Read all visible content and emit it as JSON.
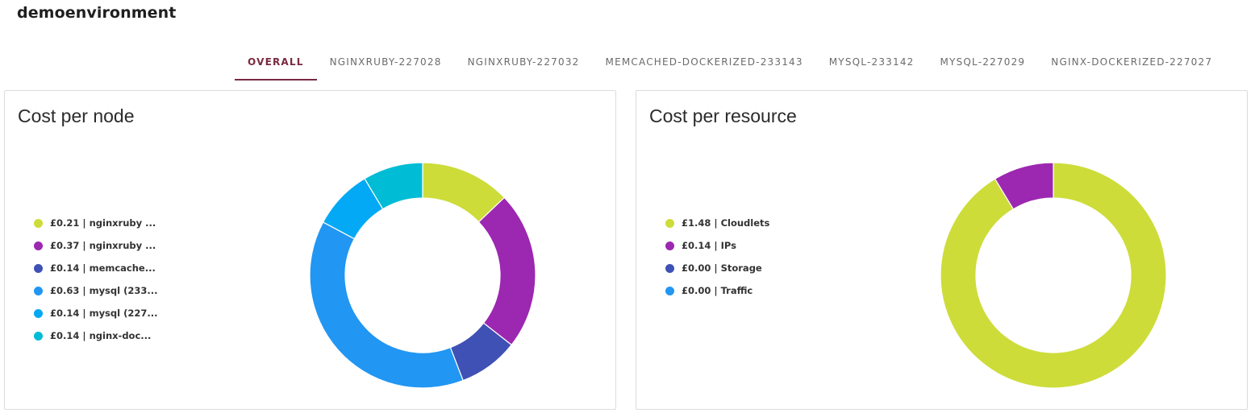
{
  "environment": {
    "name": "demoenvironment"
  },
  "tabs": [
    {
      "label": "OVERALL",
      "active": true
    },
    {
      "label": "NGINXRUBY-227028",
      "active": false
    },
    {
      "label": "NGINXRUBY-227032",
      "active": false
    },
    {
      "label": "MEMCACHED-DOCKERIZED-233143",
      "active": false
    },
    {
      "label": "MYSQL-233142",
      "active": false
    },
    {
      "label": "MYSQL-227029",
      "active": false
    },
    {
      "label": "NGINX-DOCKERIZED-227027",
      "active": false
    }
  ],
  "cost_per_node": {
    "title": "Cost per node",
    "legend": [
      {
        "label": "£0.21 | nginxruby ...",
        "color": "#cddc39"
      },
      {
        "label": "£0.37 | nginxruby ...",
        "color": "#9c27b0"
      },
      {
        "label": "£0.14 | memcache...",
        "color": "#3f51b5"
      },
      {
        "label": "£0.63 | mysql (233...",
        "color": "#2196f3"
      },
      {
        "label": "£0.14 | mysql (227...",
        "color": "#03a9f4"
      },
      {
        "label": "£0.14 | nginx-doc...",
        "color": "#00bcd4"
      }
    ]
  },
  "cost_per_resource": {
    "title": "Cost per resource",
    "legend": [
      {
        "label": "£1.48 | Cloudlets",
        "color": "#cddc39"
      },
      {
        "label": "£0.14 | IPs",
        "color": "#9c27b0"
      },
      {
        "label": "£0.00 | Storage",
        "color": "#3f51b5"
      },
      {
        "label": "£0.00 | Traffic",
        "color": "#2196f3"
      }
    ]
  },
  "chart_data": [
    {
      "type": "pie",
      "variant": "donut",
      "title": "Cost per node",
      "currency": "£",
      "categories": [
        "nginxruby ...",
        "nginxruby ...",
        "memcache...",
        "mysql (233...",
        "mysql (227...",
        "nginx-doc..."
      ],
      "values": [
        0.21,
        0.37,
        0.14,
        0.63,
        0.14,
        0.14
      ],
      "colors": [
        "#cddc39",
        "#9c27b0",
        "#3f51b5",
        "#2196f3",
        "#03a9f4",
        "#00bcd4"
      ],
      "legend_position": "left"
    },
    {
      "type": "pie",
      "variant": "donut",
      "title": "Cost per resource",
      "currency": "£",
      "categories": [
        "Cloudlets",
        "IPs",
        "Storage",
        "Traffic"
      ],
      "values": [
        1.48,
        0.14,
        0.0,
        0.0
      ],
      "colors": [
        "#cddc39",
        "#9c27b0",
        "#3f51b5",
        "#2196f3"
      ],
      "legend_position": "left"
    }
  ]
}
